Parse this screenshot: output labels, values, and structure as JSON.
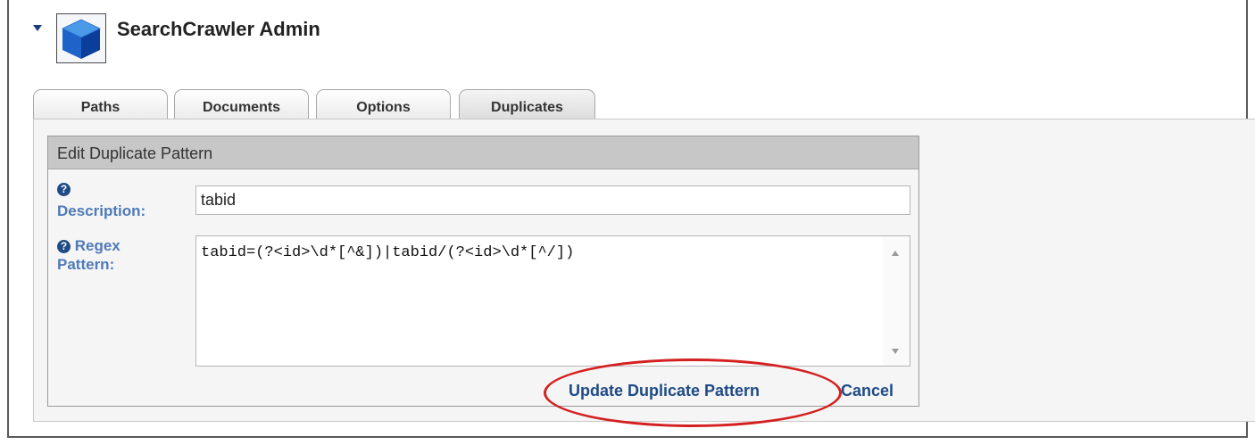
{
  "module": {
    "title": "SearchCrawler Admin",
    "icon": "cube-icon"
  },
  "tabs": [
    {
      "label": "Paths",
      "active": false
    },
    {
      "label": "Documents",
      "active": false
    },
    {
      "label": "Options",
      "active": false
    },
    {
      "label": "Duplicates",
      "active": true
    }
  ],
  "edit_form": {
    "header": "Edit Duplicate Pattern",
    "help_icon_glyph": "?",
    "description": {
      "label": "Description:",
      "value": "tabid"
    },
    "regex": {
      "label_line1": "Regex",
      "label_line2": "Pattern:",
      "value": "tabid=(?<id>\\d*[^&])|tabid/(?<id>\\d*[^/])"
    },
    "actions": {
      "update_label": "Update Duplicate Pattern",
      "cancel_label": "Cancel"
    }
  },
  "colors": {
    "link": "#1e4a86",
    "label": "#4f7ab8",
    "highlight": "#d42020"
  }
}
